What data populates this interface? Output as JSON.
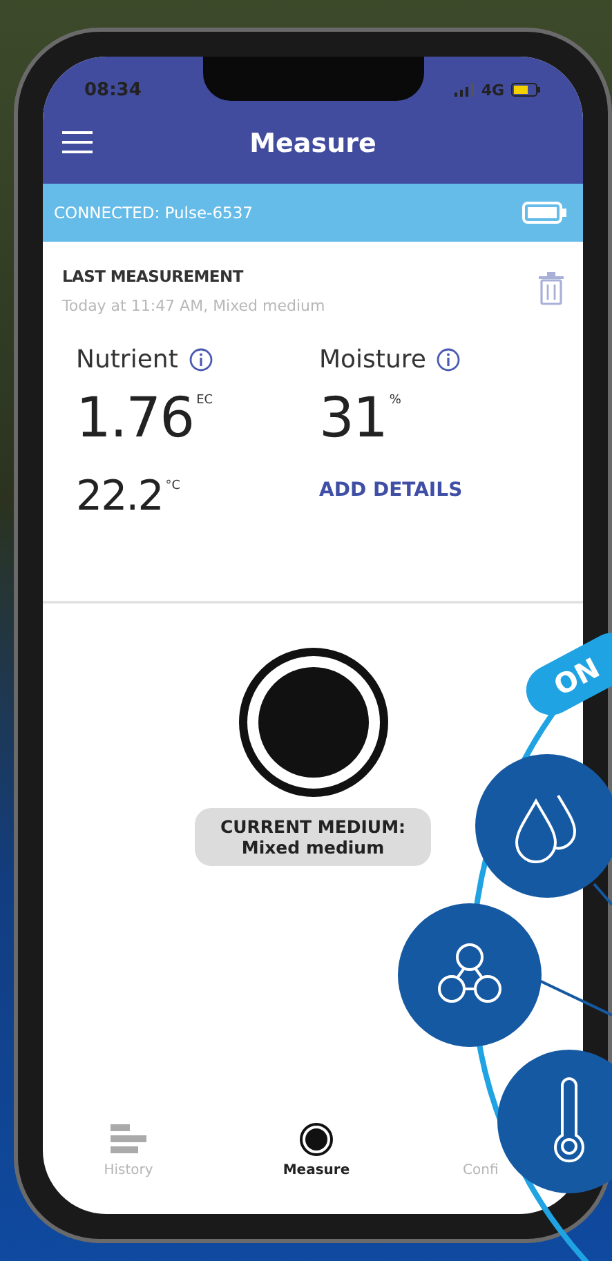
{
  "status_bar": {
    "time": "08:34",
    "network": "4G"
  },
  "header": {
    "title": "Measure"
  },
  "connection": {
    "text": "CONNECTED: Pulse-6537"
  },
  "last_measurement": {
    "heading": "LAST MEASUREMENT",
    "subtitle": "Today at 11:47 AM, Mixed medium",
    "metrics": [
      {
        "label": "Nutrient",
        "value": "1.76",
        "unit": "EC"
      },
      {
        "label": "Moisture",
        "value": "31",
        "unit": "%"
      }
    ],
    "temperature": {
      "value": "22.2",
      "unit": "°C"
    },
    "add_details": "ADD DETAILS"
  },
  "current_medium": {
    "label": "CURRENT MEDIUM:",
    "value": "Mixed medium"
  },
  "nav": [
    {
      "kind": "history",
      "label": "History",
      "selected": false
    },
    {
      "kind": "measure",
      "label": "Measure",
      "selected": true
    },
    {
      "kind": "config",
      "label": "Confi",
      "selected": false
    }
  ],
  "overlay": {
    "badge": "ON"
  }
}
